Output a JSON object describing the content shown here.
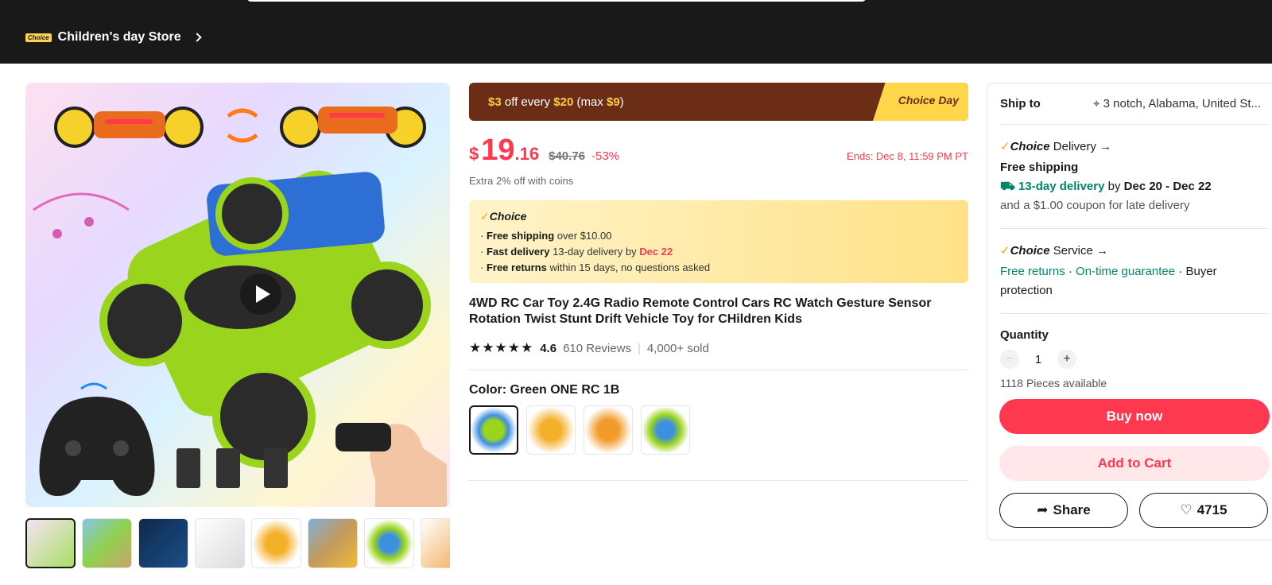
{
  "header": {
    "store_badge": "Choice",
    "store_name": "Children's day Store"
  },
  "promo": {
    "text_prefix": "$3",
    "text_mid": " off every ",
    "threshold": "$20",
    "text_max_prefix": " (max ",
    "max_amount": "$9",
    "text_max_suffix": ")",
    "tag": "Choice Day"
  },
  "price": {
    "currency": "$",
    "integer": "19",
    "decimal": ".16",
    "original": "$40.76",
    "discount": "-53%",
    "ends": "Ends: Dec 8, 11:59 PM PT",
    "coins_note": "Extra 2% off with coins"
  },
  "choice_box": {
    "title": "Choice",
    "free_shipping_label": "Free shipping",
    "free_shipping_rest": " over $10.00",
    "fast_delivery_label": "Fast delivery",
    "fast_delivery_rest": " 13-day delivery by ",
    "fast_delivery_date": "Dec 22",
    "free_returns_label": "Free returns",
    "free_returns_rest": "  within 15 days, no questions asked"
  },
  "product": {
    "title": "4WD RC Car Toy 2.4G Radio Remote Control Cars RC Watch Gesture Sensor Rotation Twist Stunt Drift Vehicle Toy for CHildren Kids",
    "rating": "4.6",
    "rating_value": 4.6,
    "reviews": "610 Reviews",
    "separator": "|",
    "sold": "4,000+ sold",
    "color_label": "Color: Green ONE RC 1B",
    "selected_swatch": 1,
    "swatch_count": 4
  },
  "gallery": {
    "thumb_count": 8,
    "selected_thumb": 1
  },
  "side": {
    "ship_to_label": "Ship to",
    "ship_to_address": "3 notch, Alabama, United St...",
    "delivery_brand": "Choice",
    "delivery_label": "Delivery",
    "free_shipping": "Free shipping",
    "delivery_days": "13-day delivery",
    "delivery_by": " by ",
    "delivery_range": "Dec 20 - Dec 22",
    "coupon_note": "and a $1.00 coupon for late delivery",
    "service_brand": "Choice",
    "service_label": "Service",
    "free_returns": "Free returns",
    "dot": " · ",
    "ontime": "On-time guarantee",
    "buyer_protection": "Buyer protection",
    "quantity_label": "Quantity",
    "quantity_minus": "−",
    "quantity_value": "1",
    "quantity_plus": "+",
    "available": "1118 Pieces available",
    "buy_now": "Buy now",
    "add_to_cart": "Add to Cart",
    "share": "Share",
    "wishlist_count": "4715"
  },
  "colors": {
    "accent_red": "#fd384f",
    "choice_yellow": "#ffd54a",
    "promo_brown": "#6b2d16",
    "green_text": "#00856a",
    "topbar_bg": "#191919"
  }
}
